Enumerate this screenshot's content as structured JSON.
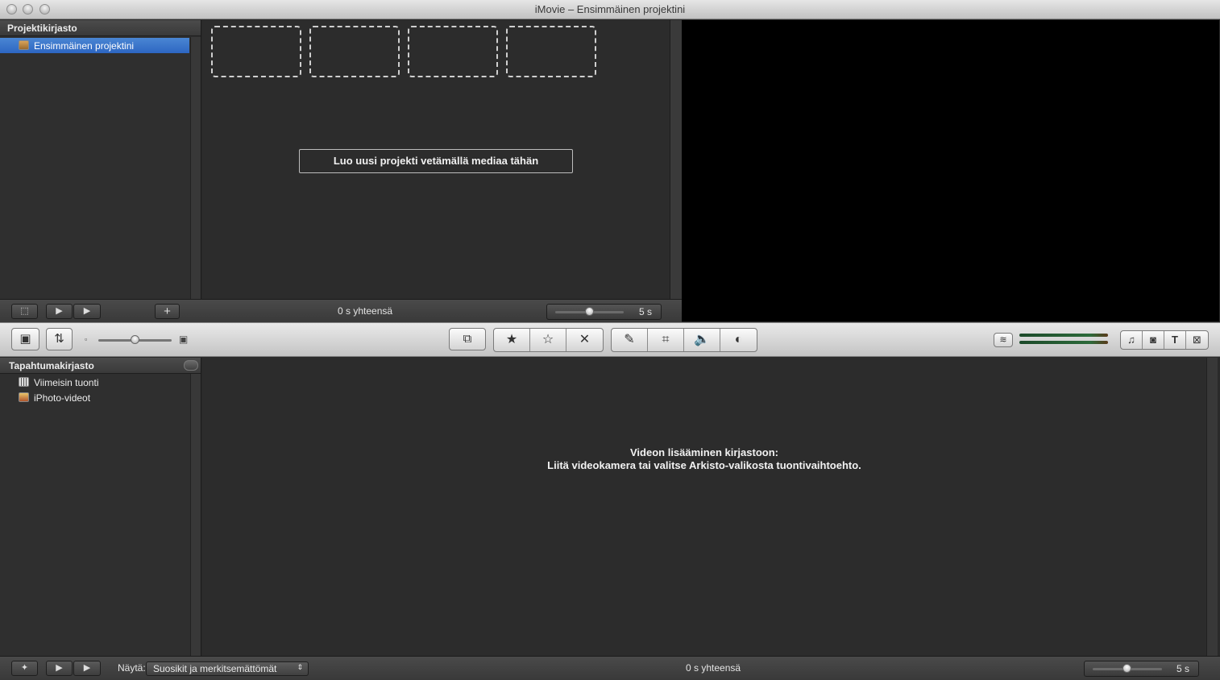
{
  "window": {
    "title": "iMovie – Ensimmäinen projektini"
  },
  "project_library": {
    "header": "Projektikirjasto",
    "items": [
      {
        "label": "Ensimmäinen projektini",
        "icon": "project-icon",
        "selected": true
      }
    ]
  },
  "project_browser": {
    "hint": "Luo uusi projekti vetämällä mediaa tähän",
    "total": "0 s yhteensä",
    "zoom_label": "5 s"
  },
  "toolbar": {
    "left_buttons": [
      "camera-import-icon",
      "swap-icon"
    ],
    "edit_group": [
      "star-filled-icon",
      "star-empty-icon",
      "reject-x-icon"
    ],
    "tool_group": [
      "eyedropper-icon",
      "crop-icon",
      "audio-icon",
      "color-adjust-icon"
    ],
    "browser_group": [
      "music-icon",
      "photo-icon",
      "title-icon",
      "transition-icon"
    ]
  },
  "event_library": {
    "header": "Tapahtumakirjasto",
    "items": [
      {
        "label": "Viimeisin tuonti",
        "icon": "film-icon"
      },
      {
        "label": "iPhoto-videot",
        "icon": "iphoto-icon"
      }
    ]
  },
  "event_browser": {
    "message_line1": "Videon lisääminen kirjastoon:",
    "message_line2": "Liitä videokamera tai valitse Arkisto-valikosta tuontivaihtoehto.",
    "total": "0 s yhteensä",
    "show_label": "Näytä:",
    "show_value": "Suosikit ja merkitsemättömät",
    "zoom_label": "5 s"
  }
}
